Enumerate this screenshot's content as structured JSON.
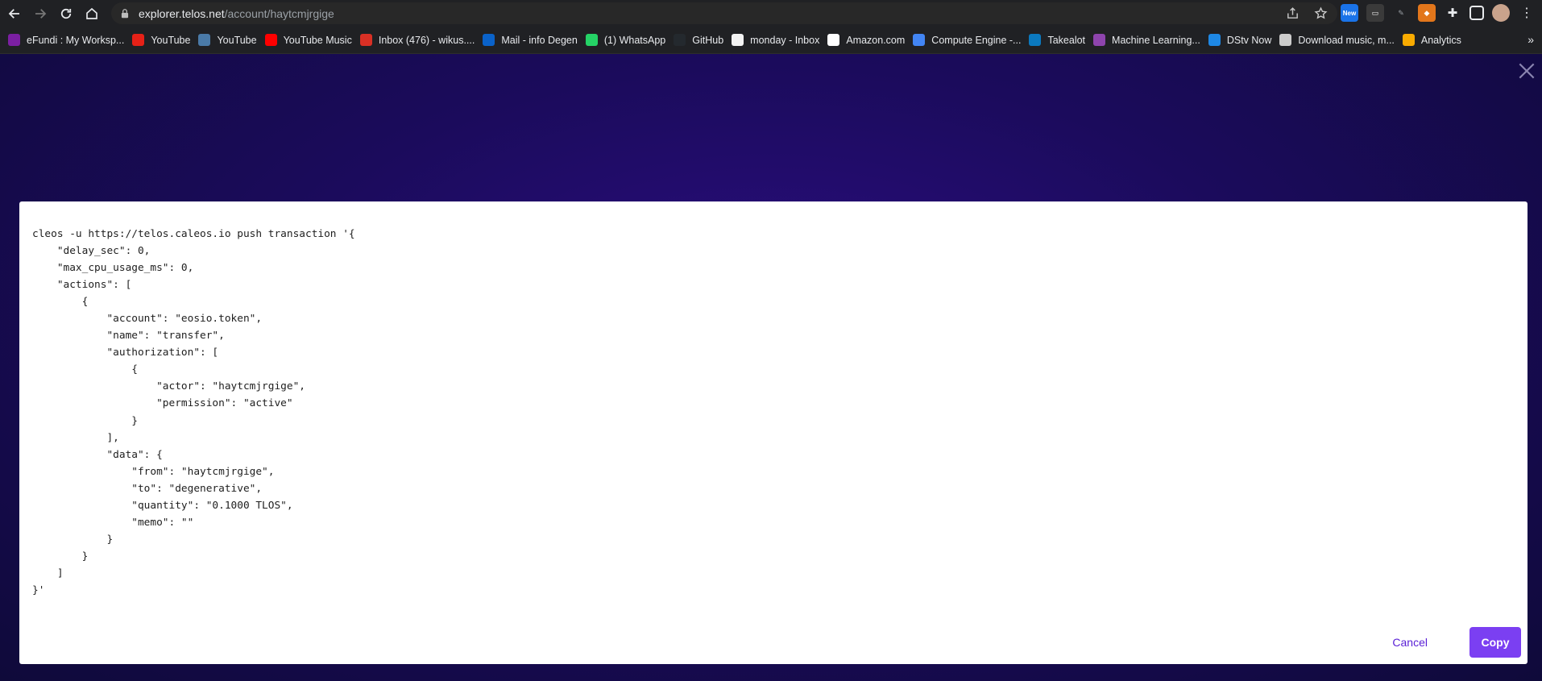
{
  "browser": {
    "url_host": "explorer.telos.net",
    "url_path": "/account/haytcmjrgige",
    "extension_badge": "New",
    "bookmarks": [
      {
        "label": "eFundi : My Worksp...",
        "icon": "efundi-icon",
        "color": "#7b1fa2"
      },
      {
        "label": "YouTube",
        "icon": "youtube-icon",
        "color": "#e62117"
      },
      {
        "label": "YouTube",
        "icon": "image-thumb-icon",
        "color": "#4a7aa8"
      },
      {
        "label": "YouTube Music",
        "icon": "youtube-music-icon",
        "color": "#ff0000"
      },
      {
        "label": "Inbox (476) - wikus....",
        "icon": "gmail-icon",
        "color": "#d93025"
      },
      {
        "label": "Mail - info Degen",
        "icon": "outlook-icon",
        "color": "#0a62c9"
      },
      {
        "label": "(1) WhatsApp",
        "icon": "whatsapp-icon",
        "color": "#25d366"
      },
      {
        "label": "GitHub",
        "icon": "github-icon",
        "color": "#24292e"
      },
      {
        "label": "monday - Inbox",
        "icon": "monday-icon",
        "color": "#f3f3f3"
      },
      {
        "label": "Amazon.com",
        "icon": "amazon-icon",
        "color": "#ffffff"
      },
      {
        "label": "Compute Engine -...",
        "icon": "compute-engine-icon",
        "color": "#4285f4"
      },
      {
        "label": "Takealot",
        "icon": "takealot-icon",
        "color": "#0b79bf"
      },
      {
        "label": "Machine Learning...",
        "icon": "ml-icon",
        "color": "#8e44ad"
      },
      {
        "label": "DStv Now",
        "icon": "dstv-icon",
        "color": "#1e88e5"
      },
      {
        "label": "Download music, m...",
        "icon": "download-icon",
        "color": "#cccccc"
      },
      {
        "label": "Analytics",
        "icon": "analytics-icon",
        "color": "#f9ab00"
      }
    ]
  },
  "modal": {
    "code": "cleos -u https://telos.caleos.io push transaction '{\n    \"delay_sec\": 0,\n    \"max_cpu_usage_ms\": 0,\n    \"actions\": [\n        {\n            \"account\": \"eosio.token\",\n            \"name\": \"transfer\",\n            \"authorization\": [\n                {\n                    \"actor\": \"haytcmjrgige\",\n                    \"permission\": \"active\"\n                }\n            ],\n            \"data\": {\n                \"from\": \"haytcmjrgige\",\n                \"to\": \"degenerative\",\n                \"quantity\": \"0.1000 TLOS\",\n                \"memo\": \"\"\n            }\n        }\n    ]\n}'",
    "cancel_label": "Cancel",
    "copy_label": "Copy"
  },
  "colors": {
    "accent": "#7b3ff2",
    "link": "#5b21d6"
  }
}
